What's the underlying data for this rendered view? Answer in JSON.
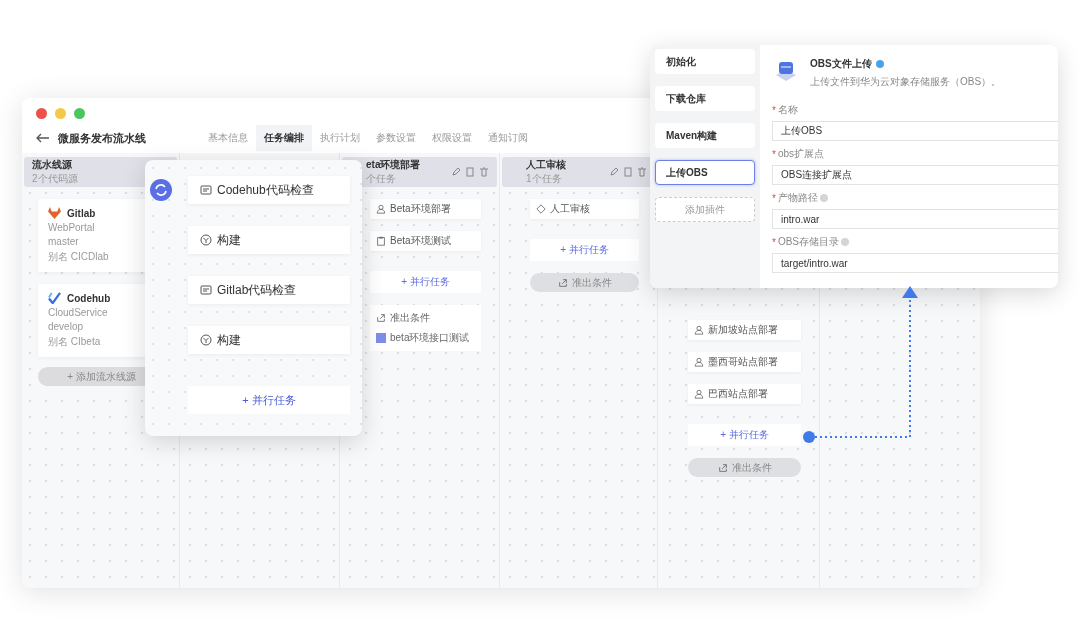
{
  "window": {
    "title": "微服务发布流水线"
  },
  "tabs": [
    {
      "label": "基本信息",
      "selected": false
    },
    {
      "label": "任务编排",
      "selected": true
    },
    {
      "label": "执行计划",
      "selected": false
    },
    {
      "label": "参数设置",
      "selected": false
    },
    {
      "label": "权限设置",
      "selected": false
    },
    {
      "label": "通知订阅",
      "selected": false
    }
  ],
  "source_stage": {
    "title": "流水线源",
    "subtitle": "2个代码源",
    "repos": [
      {
        "kind": "gitlab",
        "name": "Gitlab",
        "repo": "WebPortal",
        "branch": "master",
        "alias": "别名 CICDlab"
      },
      {
        "kind": "codehub",
        "name": "Codehub",
        "repo": "CloudService",
        "branch": "develop",
        "alias": "别名 CIbeta"
      }
    ],
    "add_button": "+ 添加流水线源"
  },
  "stages": [
    {
      "title": "eta环境部署",
      "subtitle": "个任务",
      "tasks": [
        {
          "kind": "deploy",
          "label": "Beta环境部署"
        },
        {
          "kind": "test",
          "label": "Beta环境测试"
        }
      ],
      "parallel_button": "+ 并行任务",
      "exit": {
        "kind": "card",
        "label": "准出条件",
        "item": "beta环境接口测试"
      }
    },
    {
      "title": "人工审核",
      "subtitle": "1个任务",
      "tasks": [
        {
          "kind": "approve",
          "label": "人工审核"
        }
      ],
      "parallel_button": "+ 并行任务",
      "exit": {
        "kind": "button",
        "label": "准出条件"
      }
    },
    {
      "tasks": [
        {
          "kind": "deploy",
          "label": "新加坡站点部署"
        },
        {
          "kind": "deploy",
          "label": "墨西哥站点部署"
        },
        {
          "kind": "deploy",
          "label": "巴西站点部署"
        }
      ],
      "parallel_button": "+ 并行任务",
      "exit": {
        "kind": "button",
        "label": "准出条件"
      }
    }
  ],
  "job_popover": {
    "tasks": [
      {
        "kind": "check",
        "label": "Codehub代码检查"
      },
      {
        "kind": "build",
        "label": "构建"
      },
      {
        "kind": "check",
        "label": "Gitlab代码检查"
      },
      {
        "kind": "build",
        "label": "构建"
      }
    ],
    "parallel_button": "+ 并行任务"
  },
  "plugin_panel": {
    "steps": [
      {
        "label": "初始化",
        "selected": false
      },
      {
        "label": "下载仓库",
        "selected": false
      },
      {
        "label": "Maven构建",
        "selected": false
      },
      {
        "label": "上传OBS",
        "selected": true
      }
    ],
    "add_button": "添加插件",
    "required_mark": "*",
    "plugin": {
      "title": "OBS文件上传",
      "description": "上传文件到华为云对象存储服务（OBS）。"
    },
    "fields": [
      {
        "label": "名称",
        "required": true,
        "help": false,
        "value": "上传OBS"
      },
      {
        "label": "obs扩展点",
        "required": true,
        "help": false,
        "value": "OBS连接扩展点"
      },
      {
        "label": "产物路径",
        "required": true,
        "help": true,
        "value": "intro.war"
      },
      {
        "label": "OBS存储目录",
        "required": true,
        "help": true,
        "value": "target/intro.war"
      }
    ]
  }
}
